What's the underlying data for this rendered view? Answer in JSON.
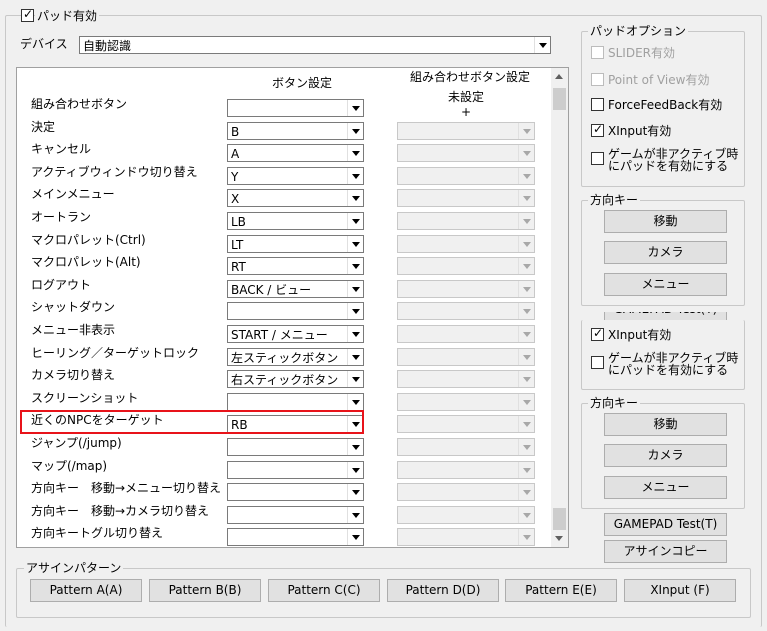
{
  "pad_enabled": {
    "label": "パッド有効",
    "checked": true
  },
  "device": {
    "label": "デバイス",
    "value": "自動認識"
  },
  "columns": {
    "button_setting": "ボタン設定",
    "combo_setting": "組み合わせボタン設定",
    "unset": "未設定",
    "plus": "+"
  },
  "rows": [
    {
      "label": "組み合わせボタン",
      "value": "",
      "combo_enabled": false,
      "hidden_combo": true
    },
    {
      "label": "決定",
      "value": "B"
    },
    {
      "label": "キャンセル",
      "value": "A"
    },
    {
      "label": "アクティブウィンドウ切り替え",
      "value": "Y"
    },
    {
      "label": "メインメニュー",
      "value": "X"
    },
    {
      "label": "オートラン",
      "value": "LB"
    },
    {
      "label": "マクロパレット(Ctrl)",
      "value": "LT"
    },
    {
      "label": "マクロパレット(Alt)",
      "value": "RT"
    },
    {
      "label": "ログアウト",
      "value": "BACK / ビュー"
    },
    {
      "label": "シャットダウン",
      "value": ""
    },
    {
      "label": "メニュー非表示",
      "value": "START / メニュー"
    },
    {
      "label": "ヒーリング／ターゲットロック",
      "value": "左スティックボタン"
    },
    {
      "label": "カメラ切り替え",
      "value": "右スティックボタン"
    },
    {
      "label": "スクリーンショット",
      "value": ""
    },
    {
      "label": "近くのNPCをターゲット",
      "value": "RB"
    },
    {
      "label": "ジャンプ(/jump)",
      "value": ""
    },
    {
      "label": "マップ(/map)",
      "value": ""
    },
    {
      "label": "方向キー　移動→メニュー切り替え",
      "value": ""
    },
    {
      "label": "方向キー　移動→カメラ切り替え",
      "value": ""
    },
    {
      "label": "方向キートグル切り替え",
      "value": ""
    }
  ],
  "pad_options": {
    "title": "パッドオプション",
    "slider": "SLIDER有効",
    "pov": "Point of View有効",
    "ffb": "ForceFeedBack有効",
    "xinput": "XInput有効",
    "inactive_line1": "ゲームが非アクティブ時",
    "inactive_line2": "にパッドを有効にする"
  },
  "dir_keys": {
    "title": "方向キー",
    "move": "移動",
    "camera": "カメラ",
    "menu": "メニュー"
  },
  "gamepad_test_partial": "GAMEPAD Test(T)",
  "pad_options2": {
    "xinput": "XInput有効",
    "inactive_line1": "ゲームが非アクティブ時",
    "inactive_line2": "にパッドを有効にする"
  },
  "dir_keys2": {
    "title": "方向キー",
    "move": "移動",
    "camera": "カメラ",
    "menu": "メニュー"
  },
  "gamepad_test": "GAMEPAD Test(T)",
  "assign_copy": "アサインコピー",
  "assign_pattern": {
    "title": "アサインパターン",
    "buttons": [
      "Pattern A(A)",
      "Pattern B(B)",
      "Pattern C(C)",
      "Pattern D(D)",
      "Pattern E(E)",
      "XInput (F)"
    ]
  },
  "colors": {
    "highlight": "#e8131a"
  }
}
